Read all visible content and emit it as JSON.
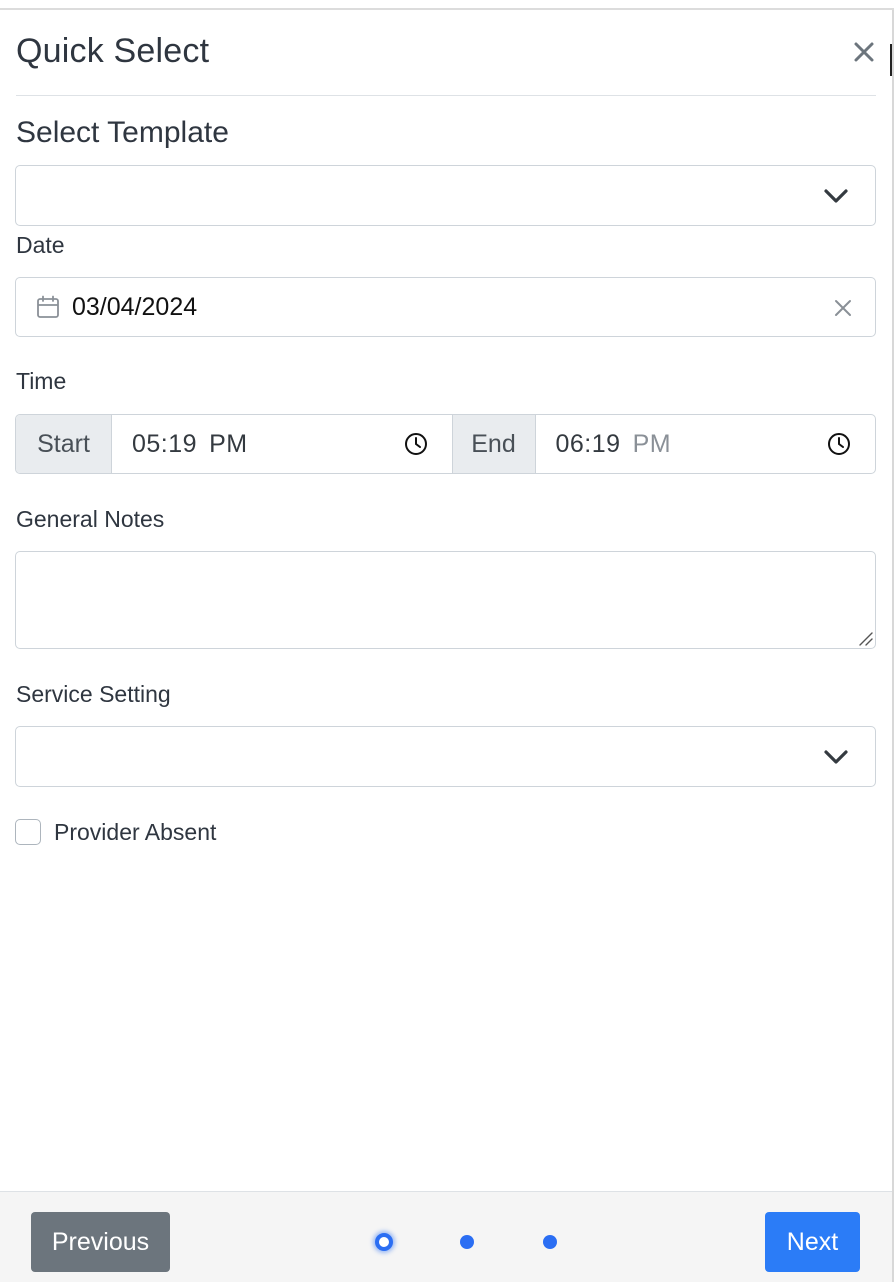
{
  "modal": {
    "title": "Quick Select"
  },
  "form": {
    "template": {
      "label": "Select Template",
      "value": ""
    },
    "date": {
      "label": "Date",
      "value": "03/04/2024"
    },
    "time": {
      "label": "Time",
      "start_label": "Start",
      "start_value": "05:19",
      "start_ampm": "PM",
      "end_label": "End",
      "end_value": "06:19",
      "end_ampm": "PM"
    },
    "notes": {
      "label": "General Notes",
      "value": ""
    },
    "service_setting": {
      "label": "Service Setting",
      "value": ""
    },
    "provider_absent": {
      "label": "Provider Absent",
      "checked": false
    }
  },
  "footer": {
    "previous_label": "Previous",
    "next_label": "Next",
    "step_count": 3,
    "active_step": 1
  },
  "colors": {
    "primary": "#2b7cf7",
    "secondary": "#6c757d",
    "addon_bg": "#e9ecef",
    "footer_bg": "#f5f5f5"
  },
  "icons": [
    "close-icon",
    "chevron-down-icon",
    "calendar-icon",
    "clear-icon",
    "clock-icon",
    "resize-grip-icon"
  ]
}
